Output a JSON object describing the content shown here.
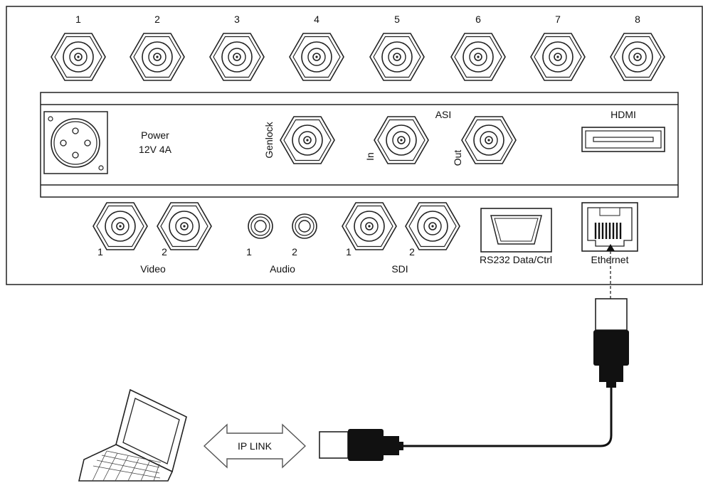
{
  "top_connectors": [
    "1",
    "2",
    "3",
    "4",
    "5",
    "6",
    "7",
    "8"
  ],
  "power": {
    "line1": "Power",
    "line2": "12V 4A"
  },
  "genlock_label": "Genlock",
  "asi": {
    "title": "ASI",
    "in_label": "In",
    "out_label": "Out"
  },
  "hdmi_label": "HDMI",
  "video": {
    "label": "Video",
    "ports": [
      "1",
      "2"
    ]
  },
  "audio": {
    "label": "Audio",
    "ports": [
      "1",
      "2"
    ]
  },
  "sdi": {
    "label": "SDI",
    "ports": [
      "1",
      "2"
    ]
  },
  "rs232_label": "RS232 Data/Ctrl",
  "ethernet_label": "Ethernet",
  "ip_link_label": "IP LINK"
}
